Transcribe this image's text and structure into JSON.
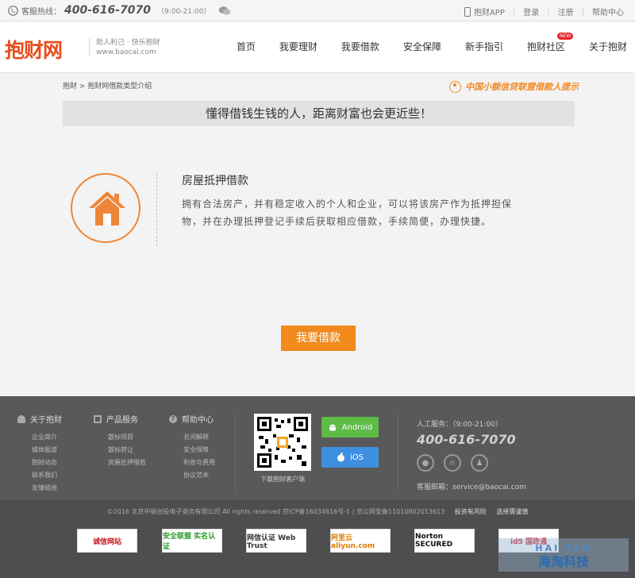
{
  "topbar": {
    "hotline_label": "客服热线：",
    "hotline_number": "400-616-7070",
    "hotline_hours": "（9:00-21:00）",
    "links": [
      "抱财APP",
      "登录",
      "注册",
      "帮助中心"
    ]
  },
  "header": {
    "logo": "抱财网",
    "slogan_line1": "助人利己 · 快乐抱财",
    "slogan_line2": "www.baocai.com",
    "nav": [
      "首页",
      "我要理财",
      "我要借款",
      "安全保障",
      "新手指引",
      "抱财社区",
      "关于抱财"
    ],
    "new_badge": "NEW"
  },
  "breadcrumb": "抱财 > 抱财网借款类型介绍",
  "league_notice": "中国小额信贷联盟借款人提示",
  "banner": "懂得借钱生钱的人，距离财富也会更近些！",
  "loan": {
    "title": "房屋抵押借款",
    "description": "拥有合法房产，并有稳定收入的个人和企业，可以将该房产作为抵押担保物，并在办理抵押登记手续后获取相应借款，手续简便，办理快捷。"
  },
  "cta_label": "我要借款",
  "footer": {
    "cols": [
      {
        "title": "关于抱财",
        "links": [
          "企业简介",
          "媒体报道",
          "抱财动态",
          "联系我们",
          "友情链接"
        ]
      },
      {
        "title": "产品服务",
        "links": [
          "散标项目",
          "散标转让",
          "房屋抵押借款"
        ]
      },
      {
        "title": "帮助中心",
        "links": [
          "名词解释",
          "安全保障",
          "利息与费用",
          "协议范本"
        ]
      }
    ],
    "qr_caption": "下载抱财客户端",
    "android": "Android",
    "ios": "iOS",
    "service_label": "人工服务：（9:00-21:00）",
    "service_number": "400-616-7070",
    "service_mail": "客服邮箱：service@baocai.com",
    "copyright": "©2016 北京中联创投电子商务有限公司 All rights reserved 京ICP备16034616号-1 | 京公网安备11010802013613",
    "risk": "投资有风险",
    "caution": "选择需谨慎",
    "certs": [
      "诚信网站",
      "安全联盟 实名认证",
      "网信认证 Web Trust",
      "阿里云 aliyun.com",
      "Norton SECURED",
      "id5 国政通"
    ]
  },
  "watermark": {
    "line1": "HAI TAO",
    "line2": "海淘科技"
  },
  "colors": {
    "brand_orange": "#f08a1c",
    "logo_red": "#e84d1c",
    "footer_bg": "#595959"
  }
}
